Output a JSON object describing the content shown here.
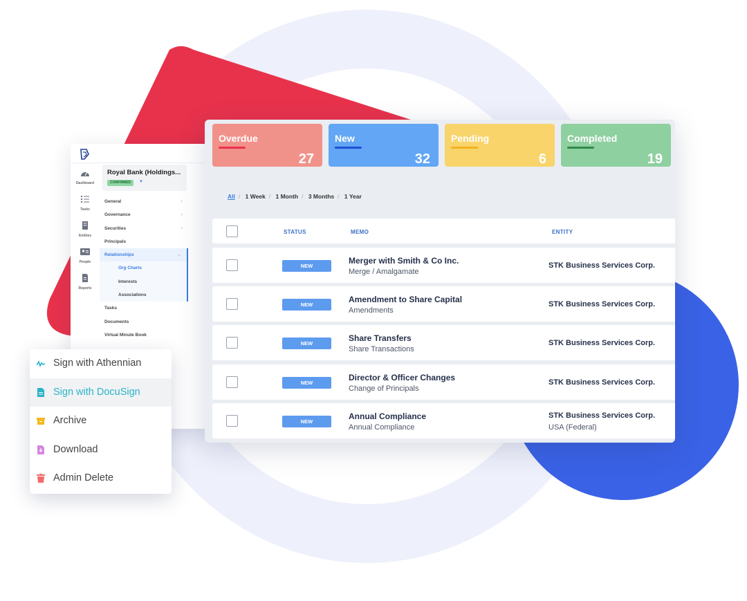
{
  "colors": {
    "overdue": "#f1928a",
    "new": "#62a6f5",
    "pending": "#f8d46b",
    "completed": "#8fd0a0",
    "red_shape": "#e8324c",
    "blue_shape": "#3a62e6",
    "accent": "#3a7be0"
  },
  "sidebar": {
    "icons": [
      {
        "icon": "dashboard-icon",
        "label": "Dashboard"
      },
      {
        "icon": "tasks-icon",
        "label": "Tasks"
      },
      {
        "icon": "entities-icon",
        "label": "Entities"
      },
      {
        "icon": "people-icon",
        "label": "People"
      },
      {
        "icon": "reports-icon",
        "label": "Reports"
      }
    ],
    "entity_name": "Royal Bank (Holdings...",
    "entity_status": "CONFIRMED",
    "nav": [
      "General",
      "Governance",
      "Securities",
      "Principals",
      "Relationships",
      "Org Charts",
      "Interests",
      "Associations",
      "Tasks",
      "Documents",
      "Virtual Minute Book"
    ]
  },
  "summary_cards": [
    {
      "label": "Overdue",
      "count": "27"
    },
    {
      "label": "New",
      "count": "32"
    },
    {
      "label": "Pending",
      "count": "6"
    },
    {
      "label": "Completed",
      "count": "19"
    }
  ],
  "filters": [
    "All",
    "1 Week",
    "1 Month",
    "3 Months",
    "1 Year"
  ],
  "table": {
    "headers": {
      "status": "STATUS",
      "memo": "MEMO",
      "entity": "ENTITY"
    },
    "rows": [
      {
        "status": "NEW",
        "memo_title": "Merger with Smith & Co Inc.",
        "memo_sub": "Merge / Amalgamate",
        "entity": "STK Business Services Corp.",
        "entity_sub": ""
      },
      {
        "status": "NEW",
        "memo_title": "Amendment to Share Capital",
        "memo_sub": "Amendments",
        "entity": "STK Business Services Corp.",
        "entity_sub": ""
      },
      {
        "status": "NEW",
        "memo_title": "Share Transfers",
        "memo_sub": "Share Transactions",
        "entity": "STK Business Services Corp.",
        "entity_sub": ""
      },
      {
        "status": "NEW",
        "memo_title": "Director & Officer Changes",
        "memo_sub": "Change of Principals",
        "entity": "STK Business Services Corp.",
        "entity_sub": ""
      },
      {
        "status": "NEW",
        "memo_title": "Annual Compliance",
        "memo_sub": "Annual Compliance",
        "entity": "STK Business Services Corp.",
        "entity_sub": "USA (Federal)"
      }
    ]
  },
  "menu": [
    {
      "icon": "signature-icon",
      "label": "Sign with Athennian"
    },
    {
      "icon": "document-icon",
      "label": "Sign with DocuSign"
    },
    {
      "icon": "archive-icon",
      "label": "Archive"
    },
    {
      "icon": "download-file-icon",
      "label": "Download"
    },
    {
      "icon": "trash-icon",
      "label": "Admin Delete"
    }
  ]
}
